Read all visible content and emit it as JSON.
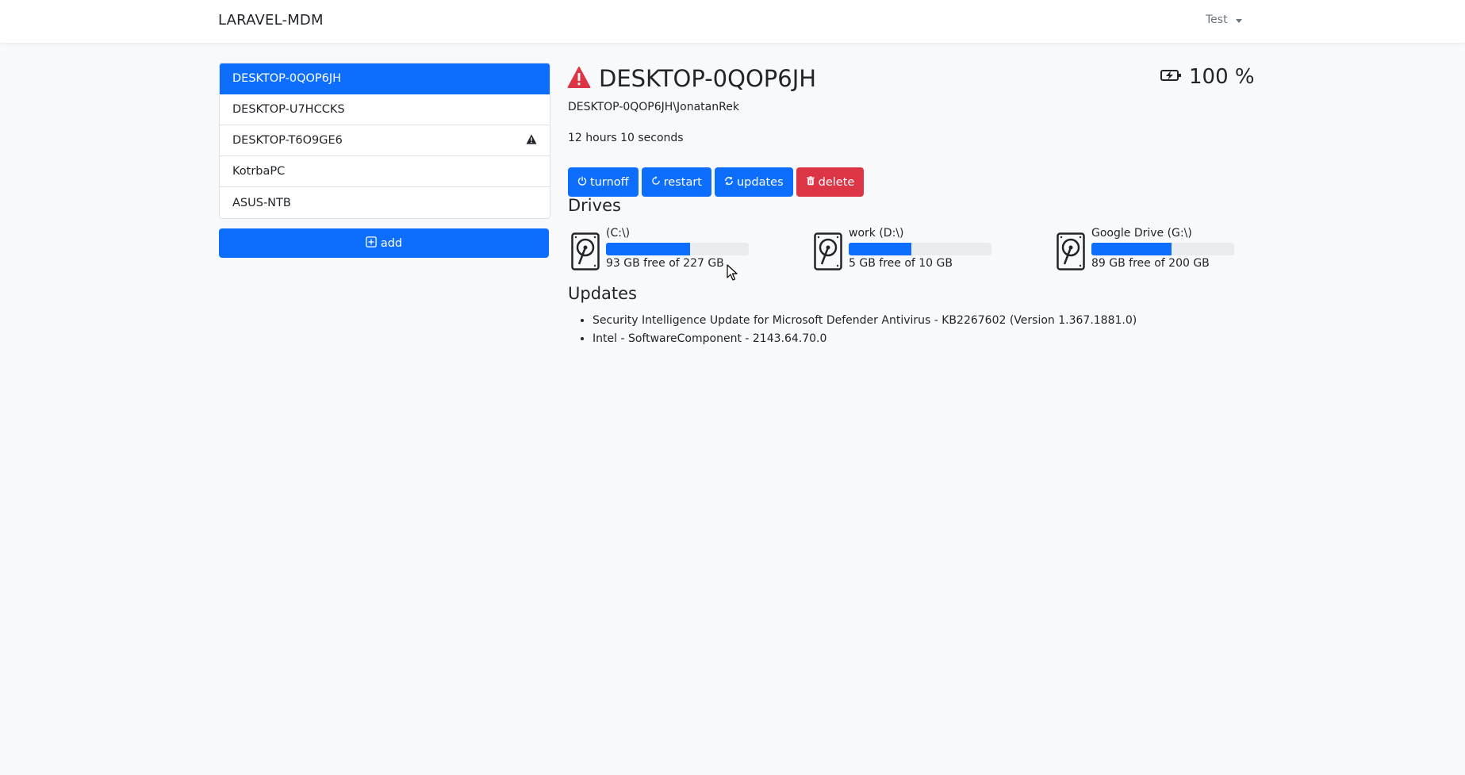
{
  "navbar": {
    "brand": "LARAVEL-MDM",
    "user": "Test"
  },
  "sidebar": {
    "devices": [
      {
        "name": "DESKTOP-0QOP6JH",
        "active": true,
        "warning": false
      },
      {
        "name": "DESKTOP-U7HCCKS",
        "active": false,
        "warning": false
      },
      {
        "name": "DESKTOP-T6O9GE6",
        "active": false,
        "warning": true
      },
      {
        "name": "KotrbaPC",
        "active": false,
        "warning": false
      },
      {
        "name": "ASUS-NTB",
        "active": false,
        "warning": false
      }
    ],
    "add_label": "add"
  },
  "device": {
    "title": "DESKTOP-0QOP6JH",
    "status_icon": "warning-triangle-icon",
    "user": "DESKTOP-0QOP6JH\\JonatanRek",
    "uptime": "12 hours 10 seconds",
    "battery": "100 %",
    "battery_icon": "battery-charging-icon"
  },
  "actions": {
    "turnoff": "turnoff",
    "restart": "restart",
    "updates": "updates",
    "delete": "delete"
  },
  "drives": {
    "title": "Drives",
    "items": [
      {
        "label": "(C:\\)",
        "free": "93 GB free of 227 GB",
        "used_fraction": 0.59
      },
      {
        "label": "work (D:\\)",
        "free": "5 GB free of 10 GB",
        "used_fraction": 0.44
      },
      {
        "label": "Google Drive (G:\\)",
        "free": "89 GB free of 200 GB",
        "used_fraction": 0.56
      }
    ]
  },
  "updates": {
    "title": "Updates",
    "items": [
      "Security Intelligence Update for Microsoft Defender Antivirus - KB2267602 (Version 1.367.1881.0)",
      "Intel - SoftwareComponent - 2143.64.70.0"
    ]
  },
  "colors": {
    "primary": "#0d6efd",
    "danger": "#dc3545",
    "warning_icon": "#dc3545"
  }
}
